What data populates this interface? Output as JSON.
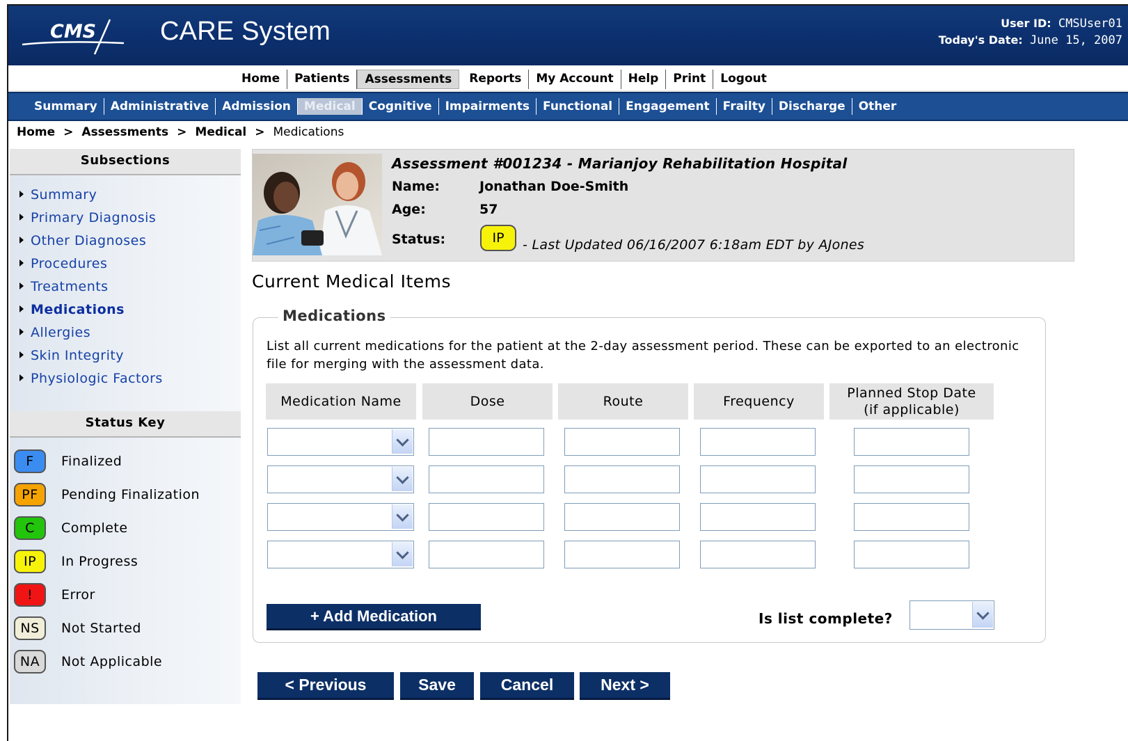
{
  "header": {
    "logo_text": "CMS",
    "app_title": "CARE System",
    "user_id_label": "User ID:",
    "user_id": "CMSUser01",
    "date_label": "Today's Date:",
    "date": "June 15, 2007",
    "bg_color": "#0d3170"
  },
  "topnav": [
    "Home",
    "Patients",
    "Assessments",
    "Reports",
    "My Account",
    "Help",
    "Print",
    "Logout"
  ],
  "topnav_active": "Assessments",
  "subnav": [
    "Summary",
    "Administrative",
    "Admission",
    "Medical",
    "Cognitive",
    "Impairments",
    "Functional",
    "Engagement",
    "Frailty",
    "Discharge",
    "Other"
  ],
  "subnav_active": "Medical",
  "breadcrumb": [
    "Home",
    "Assessments",
    "Medical",
    "Medications"
  ],
  "breadcrumb_sep": ">",
  "sidebar": {
    "subsections_title": "Subsections",
    "subsections": [
      "Summary",
      "Primary Diagnosis",
      "Other Diagnoses",
      "Procedures",
      "Treatments",
      "Medications",
      "Allergies",
      "Skin Integrity",
      "Physiologic Factors"
    ],
    "active": "Medications",
    "status_key_title": "Status Key",
    "status_key": [
      {
        "code": "F",
        "label": "Finalized",
        "color": "#3b8cf0"
      },
      {
        "code": "PF",
        "label": "Pending Finalization",
        "color": "#f5a300"
      },
      {
        "code": "C",
        "label": "Complete",
        "color": "#22c40c"
      },
      {
        "code": "IP",
        "label": "In Progress",
        "color": "#f7f20a"
      },
      {
        "code": "!",
        "label": "Error",
        "color": "#f01414"
      },
      {
        "code": "NS",
        "label": "Not Started",
        "color": "#f0eed8"
      },
      {
        "code": "NA",
        "label": "Not Applicable",
        "color": "#d9d9d9"
      }
    ]
  },
  "assessment": {
    "title": "Assessment #001234 - Marianjoy Rehabilitation Hospital",
    "name_label": "Name:",
    "name": "Jonathan Doe-Smith",
    "age_label": "Age:",
    "age": "57",
    "status_label": "Status:",
    "status_code": "IP",
    "last_updated": "- Last Updated 06/16/2007 6:18am EDT by AJones"
  },
  "main": {
    "section_title": "Current Medical Items",
    "legend": "Medications",
    "description": "List all current medications for the patient at the 2-day assessment period. These can be exported to an electronic file for merging with the assessment data.",
    "columns": [
      "Medication Name",
      "Dose",
      "Route",
      "Frequency",
      "Planned Stop Date\n(if applicable)"
    ],
    "rows": [
      {
        "medication": "",
        "dose": "",
        "route": "",
        "frequency": "",
        "stop_date": ""
      },
      {
        "medication": "",
        "dose": "",
        "route": "",
        "frequency": "",
        "stop_date": ""
      },
      {
        "medication": "",
        "dose": "",
        "route": "",
        "frequency": "",
        "stop_date": ""
      },
      {
        "medication": "",
        "dose": "",
        "route": "",
        "frequency": "",
        "stop_date": ""
      }
    ],
    "add_button": "+ Add Medication",
    "complete_label": "Is list complete?",
    "complete_value": ""
  },
  "buttons": {
    "previous": "< Previous",
    "save": "Save",
    "cancel": "Cancel",
    "next": "Next >"
  }
}
